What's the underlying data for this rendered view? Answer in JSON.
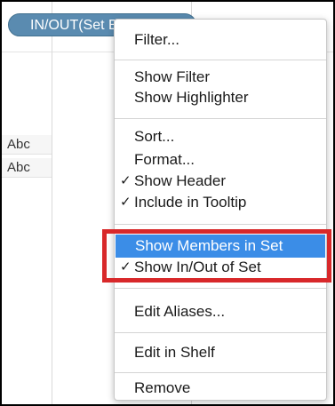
{
  "pill": {
    "label": "IN/OUT(Set Exam...",
    "dropdown_icon": "▾"
  },
  "rows": [
    "Abc",
    "Abc"
  ],
  "menu": {
    "items": [
      {
        "label": "Filter...",
        "checked": false
      },
      {
        "label": "Show Filter",
        "checked": false
      },
      {
        "label": "Show Highlighter",
        "checked": false
      },
      {
        "label": "Sort...",
        "checked": false
      },
      {
        "label": "Format...",
        "checked": false
      },
      {
        "label": "Show Header",
        "checked": true
      },
      {
        "label": "Include in Tooltip",
        "checked": true
      },
      {
        "label": "Show Members in Set",
        "checked": false,
        "highlighted": true
      },
      {
        "label": "Show In/Out of Set",
        "checked": true
      },
      {
        "label": "Edit Aliases...",
        "checked": false
      },
      {
        "label": "Edit in Shelf",
        "checked": false
      },
      {
        "label": "Remove",
        "checked": false
      }
    ],
    "check_glyph": "✓"
  },
  "colors": {
    "pill": "#5a8bb0",
    "highlight": "#3b8de7",
    "annotation": "#d8282a"
  }
}
